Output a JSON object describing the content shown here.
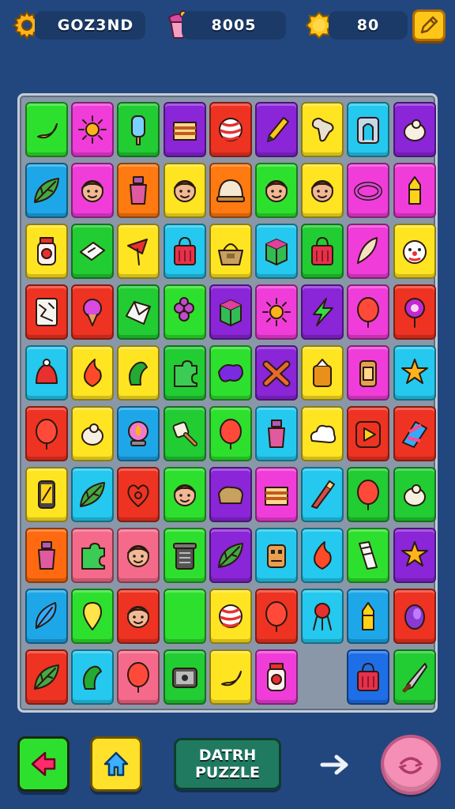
{
  "header": {
    "player_name": "GOZ3ND",
    "score": "8005",
    "coins": "80",
    "icons": [
      "gear-icon",
      "cake-icon",
      "coin-icon",
      "pencil-icon"
    ]
  },
  "board": {
    "columns": 9,
    "rows": 10,
    "tiles": [
      {
        "r": 0,
        "c": 0,
        "color": "#2ee02e",
        "icon": "banana"
      },
      {
        "r": 0,
        "c": 1,
        "color": "#f03dd9",
        "icon": "sun"
      },
      {
        "r": 0,
        "c": 2,
        "color": "#22cc33",
        "icon": "popsicle"
      },
      {
        "r": 0,
        "c": 3,
        "color": "#8a25d8",
        "icon": "sandwich"
      },
      {
        "r": 0,
        "c": 4,
        "color": "#ee3322",
        "icon": "candy-ball"
      },
      {
        "r": 0,
        "c": 5,
        "color": "#8a25d8",
        "icon": "pencil"
      },
      {
        "r": 0,
        "c": 6,
        "color": "#ffe422",
        "icon": "bone"
      },
      {
        "r": 0,
        "c": 7,
        "color": "#25c8ee",
        "icon": "arch"
      },
      {
        "r": 0,
        "c": 8,
        "color": "#8a25d8",
        "icon": "seed"
      },
      {
        "r": 1,
        "c": 0,
        "color": "#1ea7e8",
        "icon": "leaf"
      },
      {
        "r": 1,
        "c": 1,
        "color": "#f03dd9",
        "icon": "face"
      },
      {
        "r": 1,
        "c": 2,
        "color": "#ff7a10",
        "icon": "bottle"
      },
      {
        "r": 1,
        "c": 3,
        "color": "#ffe422",
        "icon": "face"
      },
      {
        "r": 1,
        "c": 4,
        "color": "#ff7a10",
        "icon": "dome"
      },
      {
        "r": 1,
        "c": 5,
        "color": "#2ee02e",
        "icon": "face"
      },
      {
        "r": 1,
        "c": 6,
        "color": "#ffe422",
        "icon": "face"
      },
      {
        "r": 1,
        "c": 7,
        "color": "#f03dd9",
        "icon": "ring"
      },
      {
        "r": 1,
        "c": 8,
        "color": "#f03dd9",
        "icon": "crayon"
      },
      {
        "r": 2,
        "c": 0,
        "color": "#ffe422",
        "icon": "jar"
      },
      {
        "r": 2,
        "c": 1,
        "color": "#22cc33",
        "icon": "card"
      },
      {
        "r": 2,
        "c": 2,
        "color": "#ffe422",
        "icon": "flag"
      },
      {
        "r": 2,
        "c": 3,
        "color": "#25c8ee",
        "icon": "bag"
      },
      {
        "r": 2,
        "c": 4,
        "color": "#ffe422",
        "icon": "basket"
      },
      {
        "r": 2,
        "c": 5,
        "color": "#25c8ee",
        "icon": "box"
      },
      {
        "r": 2,
        "c": 6,
        "color": "#22cc33",
        "icon": "bag"
      },
      {
        "r": 2,
        "c": 7,
        "color": "#f03dd9",
        "icon": "cone"
      },
      {
        "r": 2,
        "c": 8,
        "color": "#ffe422",
        "icon": "clown"
      },
      {
        "r": 3,
        "c": 0,
        "color": "#ee3322",
        "icon": "map"
      },
      {
        "r": 3,
        "c": 1,
        "color": "#ee3322",
        "icon": "icecream"
      },
      {
        "r": 3,
        "c": 2,
        "color": "#22cc33",
        "icon": "envelope"
      },
      {
        "r": 3,
        "c": 3,
        "color": "#2ee02e",
        "icon": "grapes"
      },
      {
        "r": 3,
        "c": 4,
        "color": "#8a25d8",
        "icon": "box"
      },
      {
        "r": 3,
        "c": 5,
        "color": "#f03dd9",
        "icon": "sun"
      },
      {
        "r": 3,
        "c": 6,
        "color": "#8a25d8",
        "icon": "bolt"
      },
      {
        "r": 3,
        "c": 7,
        "color": "#f03dd9",
        "icon": "balloon"
      },
      {
        "r": 3,
        "c": 8,
        "color": "#ee3322",
        "icon": "pin"
      },
      {
        "r": 4,
        "c": 0,
        "color": "#25c8ee",
        "icon": "jelly"
      },
      {
        "r": 4,
        "c": 1,
        "color": "#ffe422",
        "icon": "flame"
      },
      {
        "r": 4,
        "c": 2,
        "color": "#ffe422",
        "icon": "pepper"
      },
      {
        "r": 4,
        "c": 3,
        "color": "#22cc33",
        "icon": "puzzle"
      },
      {
        "r": 4,
        "c": 4,
        "color": "#2ee02e",
        "icon": "splash"
      },
      {
        "r": 4,
        "c": 5,
        "color": "#8a25d8",
        "icon": "cross"
      },
      {
        "r": 4,
        "c": 6,
        "color": "#ffe422",
        "icon": "jam"
      },
      {
        "r": 4,
        "c": 7,
        "color": "#f03dd9",
        "icon": "can"
      },
      {
        "r": 4,
        "c": 8,
        "color": "#25c8ee",
        "icon": "star"
      },
      {
        "r": 5,
        "c": 0,
        "color": "#ee3322",
        "icon": "balloon"
      },
      {
        "r": 5,
        "c": 1,
        "color": "#ffe422",
        "icon": "seed"
      },
      {
        "r": 5,
        "c": 2,
        "color": "#1ea7e8",
        "icon": "lamp"
      },
      {
        "r": 5,
        "c": 3,
        "color": "#22cc33",
        "icon": "shovel"
      },
      {
        "r": 5,
        "c": 4,
        "color": "#2ee02e",
        "icon": "balloon"
      },
      {
        "r": 5,
        "c": 5,
        "color": "#25c8ee",
        "icon": "bottle"
      },
      {
        "r": 5,
        "c": 6,
        "color": "#ffe422",
        "icon": "cloud"
      },
      {
        "r": 5,
        "c": 7,
        "color": "#ee3322",
        "icon": "play"
      },
      {
        "r": 5,
        "c": 8,
        "color": "#ee3322",
        "icon": "kite"
      },
      {
        "r": 6,
        "c": 0,
        "color": "#ffe422",
        "icon": "phone"
      },
      {
        "r": 6,
        "c": 1,
        "color": "#25c8ee",
        "icon": "leaf"
      },
      {
        "r": 6,
        "c": 2,
        "color": "#ee3322",
        "icon": "heart"
      },
      {
        "r": 6,
        "c": 3,
        "color": "#2ee02e",
        "icon": "face"
      },
      {
        "r": 6,
        "c": 4,
        "color": "#8a25d8",
        "icon": "bread"
      },
      {
        "r": 6,
        "c": 5,
        "color": "#f03dd9",
        "icon": "sandwich"
      },
      {
        "r": 6,
        "c": 6,
        "color": "#25c8ee",
        "icon": "brush"
      },
      {
        "r": 6,
        "c": 7,
        "color": "#22cc33",
        "icon": "balloon"
      },
      {
        "r": 6,
        "c": 8,
        "color": "#22cc33",
        "icon": "seed"
      },
      {
        "r": 7,
        "c": 0,
        "color": "#ff6a10",
        "icon": "bottle"
      },
      {
        "r": 7,
        "c": 1,
        "color": "#f56a8a",
        "icon": "puzzle"
      },
      {
        "r": 7,
        "c": 2,
        "color": "#f56a8a",
        "icon": "face"
      },
      {
        "r": 7,
        "c": 3,
        "color": "#2ee02e",
        "icon": "bin"
      },
      {
        "r": 7,
        "c": 4,
        "color": "#8a25d8",
        "icon": "leaf"
      },
      {
        "r": 7,
        "c": 5,
        "color": "#25c8ee",
        "icon": "robot"
      },
      {
        "r": 7,
        "c": 6,
        "color": "#25c8ee",
        "icon": "flame"
      },
      {
        "r": 7,
        "c": 7,
        "color": "#2ee02e",
        "icon": "ticket"
      },
      {
        "r": 7,
        "c": 8,
        "color": "#8a25d8",
        "icon": "star"
      },
      {
        "r": 8,
        "c": 0,
        "color": "#1ea7e8",
        "icon": "feather"
      },
      {
        "r": 8,
        "c": 1,
        "color": "#2ee02e",
        "icon": "bulb"
      },
      {
        "r": 8,
        "c": 2,
        "color": "#ee3322",
        "icon": "face"
      },
      {
        "r": 8,
        "c": 3,
        "color": "#2ee02e",
        "icon": "none"
      },
      {
        "r": 8,
        "c": 4,
        "color": "#ffe422",
        "icon": "candy-ball"
      },
      {
        "r": 8,
        "c": 5,
        "color": "#ee3322",
        "icon": "balloon"
      },
      {
        "r": 8,
        "c": 6,
        "color": "#25c8ee",
        "icon": "grill"
      },
      {
        "r": 8,
        "c": 7,
        "color": "#1ea7e8",
        "icon": "crayon"
      },
      {
        "r": 8,
        "c": 8,
        "color": "#ee3322",
        "icon": "egg"
      },
      {
        "r": 9,
        "c": 0,
        "color": "#ee3322",
        "icon": "leaf"
      },
      {
        "r": 9,
        "c": 1,
        "color": "#25c8ee",
        "icon": "pepper"
      },
      {
        "r": 9,
        "c": 2,
        "color": "#f56a8a",
        "icon": "balloon"
      },
      {
        "r": 9,
        "c": 3,
        "color": "#22cc33",
        "icon": "radio"
      },
      {
        "r": 9,
        "c": 4,
        "color": "#ffe422",
        "icon": "banana"
      },
      {
        "r": 9,
        "c": 5,
        "color": "#f03dd9",
        "icon": "jar"
      },
      {
        "r": 9,
        "c": 7,
        "color": "#1e6ee8",
        "icon": "bag"
      },
      {
        "r": 9,
        "c": 8,
        "color": "#22cc33",
        "icon": "knife"
      }
    ]
  },
  "footer": {
    "title_line1": "DATRH",
    "title_line2": "PUZZLE",
    "icons": [
      "back-arrow-icon",
      "home-icon",
      "next-arrow-icon",
      "shuffle-icon"
    ]
  }
}
